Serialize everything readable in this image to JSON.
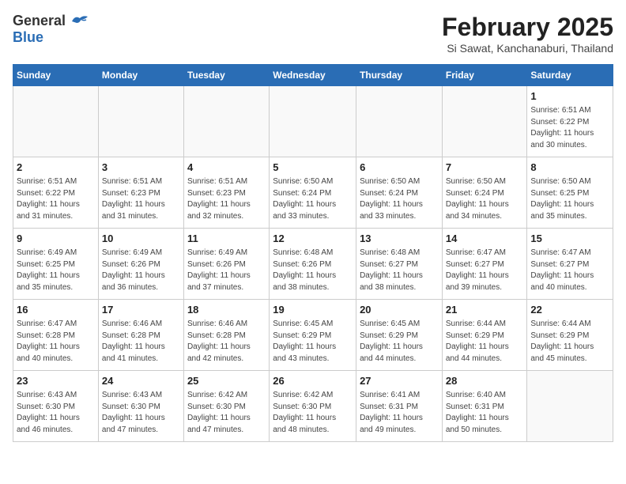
{
  "logo": {
    "general": "General",
    "blue": "Blue"
  },
  "title": "February 2025",
  "subtitle": "Si Sawat, Kanchanaburi, Thailand",
  "headers": [
    "Sunday",
    "Monday",
    "Tuesday",
    "Wednesday",
    "Thursday",
    "Friday",
    "Saturday"
  ],
  "weeks": [
    [
      {
        "day": "",
        "info": ""
      },
      {
        "day": "",
        "info": ""
      },
      {
        "day": "",
        "info": ""
      },
      {
        "day": "",
        "info": ""
      },
      {
        "day": "",
        "info": ""
      },
      {
        "day": "",
        "info": ""
      },
      {
        "day": "1",
        "info": "Sunrise: 6:51 AM\nSunset: 6:22 PM\nDaylight: 11 hours\nand 30 minutes."
      }
    ],
    [
      {
        "day": "2",
        "info": "Sunrise: 6:51 AM\nSunset: 6:22 PM\nDaylight: 11 hours\nand 31 minutes."
      },
      {
        "day": "3",
        "info": "Sunrise: 6:51 AM\nSunset: 6:23 PM\nDaylight: 11 hours\nand 31 minutes."
      },
      {
        "day": "4",
        "info": "Sunrise: 6:51 AM\nSunset: 6:23 PM\nDaylight: 11 hours\nand 32 minutes."
      },
      {
        "day": "5",
        "info": "Sunrise: 6:50 AM\nSunset: 6:24 PM\nDaylight: 11 hours\nand 33 minutes."
      },
      {
        "day": "6",
        "info": "Sunrise: 6:50 AM\nSunset: 6:24 PM\nDaylight: 11 hours\nand 33 minutes."
      },
      {
        "day": "7",
        "info": "Sunrise: 6:50 AM\nSunset: 6:24 PM\nDaylight: 11 hours\nand 34 minutes."
      },
      {
        "day": "8",
        "info": "Sunrise: 6:50 AM\nSunset: 6:25 PM\nDaylight: 11 hours\nand 35 minutes."
      }
    ],
    [
      {
        "day": "9",
        "info": "Sunrise: 6:49 AM\nSunset: 6:25 PM\nDaylight: 11 hours\nand 35 minutes."
      },
      {
        "day": "10",
        "info": "Sunrise: 6:49 AM\nSunset: 6:26 PM\nDaylight: 11 hours\nand 36 minutes."
      },
      {
        "day": "11",
        "info": "Sunrise: 6:49 AM\nSunset: 6:26 PM\nDaylight: 11 hours\nand 37 minutes."
      },
      {
        "day": "12",
        "info": "Sunrise: 6:48 AM\nSunset: 6:26 PM\nDaylight: 11 hours\nand 38 minutes."
      },
      {
        "day": "13",
        "info": "Sunrise: 6:48 AM\nSunset: 6:27 PM\nDaylight: 11 hours\nand 38 minutes."
      },
      {
        "day": "14",
        "info": "Sunrise: 6:47 AM\nSunset: 6:27 PM\nDaylight: 11 hours\nand 39 minutes."
      },
      {
        "day": "15",
        "info": "Sunrise: 6:47 AM\nSunset: 6:27 PM\nDaylight: 11 hours\nand 40 minutes."
      }
    ],
    [
      {
        "day": "16",
        "info": "Sunrise: 6:47 AM\nSunset: 6:28 PM\nDaylight: 11 hours\nand 40 minutes."
      },
      {
        "day": "17",
        "info": "Sunrise: 6:46 AM\nSunset: 6:28 PM\nDaylight: 11 hours\nand 41 minutes."
      },
      {
        "day": "18",
        "info": "Sunrise: 6:46 AM\nSunset: 6:28 PM\nDaylight: 11 hours\nand 42 minutes."
      },
      {
        "day": "19",
        "info": "Sunrise: 6:45 AM\nSunset: 6:29 PM\nDaylight: 11 hours\nand 43 minutes."
      },
      {
        "day": "20",
        "info": "Sunrise: 6:45 AM\nSunset: 6:29 PM\nDaylight: 11 hours\nand 44 minutes."
      },
      {
        "day": "21",
        "info": "Sunrise: 6:44 AM\nSunset: 6:29 PM\nDaylight: 11 hours\nand 44 minutes."
      },
      {
        "day": "22",
        "info": "Sunrise: 6:44 AM\nSunset: 6:29 PM\nDaylight: 11 hours\nand 45 minutes."
      }
    ],
    [
      {
        "day": "23",
        "info": "Sunrise: 6:43 AM\nSunset: 6:30 PM\nDaylight: 11 hours\nand 46 minutes."
      },
      {
        "day": "24",
        "info": "Sunrise: 6:43 AM\nSunset: 6:30 PM\nDaylight: 11 hours\nand 47 minutes."
      },
      {
        "day": "25",
        "info": "Sunrise: 6:42 AM\nSunset: 6:30 PM\nDaylight: 11 hours\nand 47 minutes."
      },
      {
        "day": "26",
        "info": "Sunrise: 6:42 AM\nSunset: 6:30 PM\nDaylight: 11 hours\nand 48 minutes."
      },
      {
        "day": "27",
        "info": "Sunrise: 6:41 AM\nSunset: 6:31 PM\nDaylight: 11 hours\nand 49 minutes."
      },
      {
        "day": "28",
        "info": "Sunrise: 6:40 AM\nSunset: 6:31 PM\nDaylight: 11 hours\nand 50 minutes."
      },
      {
        "day": "",
        "info": ""
      }
    ]
  ]
}
